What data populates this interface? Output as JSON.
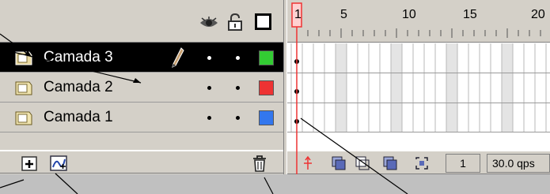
{
  "layers": [
    {
      "name": "Camada 3",
      "active": true,
      "color": "#33cc33"
    },
    {
      "name": "Camada 2",
      "active": false,
      "color": "#ee3333"
    },
    {
      "name": "Camada 1",
      "active": false,
      "color": "#3377ee"
    }
  ],
  "header_icons": [
    "eye-icon",
    "lock-icon",
    "outline-icon"
  ],
  "timeline": {
    "ruler_labels": [
      "1",
      "5",
      "10",
      "15",
      "20"
    ],
    "current_frame": "1",
    "frame_rate": "30.0 qps",
    "playhead_color": "#ff3333"
  },
  "footer_icons": [
    "insert-layer-icon",
    "motion-guide-icon",
    "trash-icon"
  ]
}
